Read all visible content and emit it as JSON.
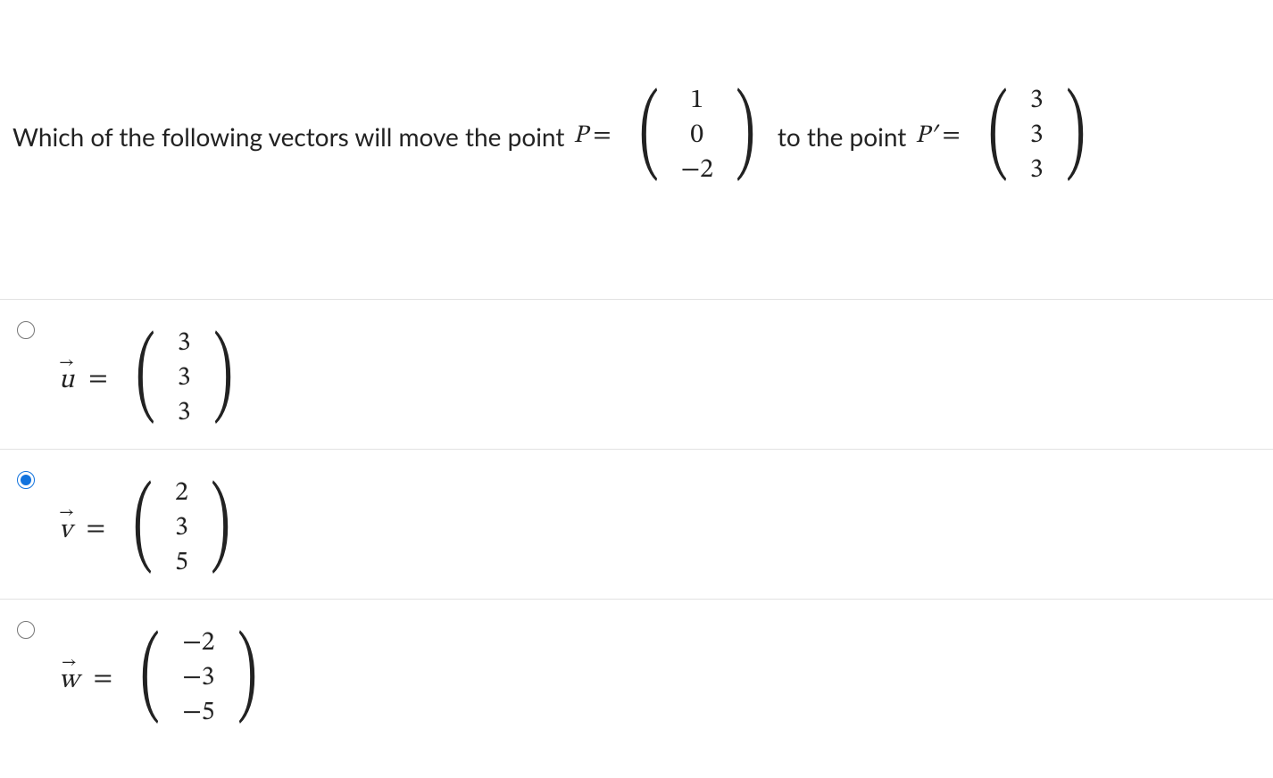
{
  "question": {
    "prefix_text": "Which of the following vectors will move the point ",
    "P_label": "P",
    "P_values": [
      "1",
      "0",
      "−2"
    ],
    "middle_text": " to the point ",
    "Pprime_label": "P′",
    "Pprime_values": [
      "3",
      "3",
      "3"
    ]
  },
  "options": [
    {
      "name": "u",
      "values": [
        "3",
        "3",
        "3"
      ],
      "selected": false
    },
    {
      "name": "v",
      "values": [
        "2",
        "3",
        "5"
      ],
      "selected": true
    },
    {
      "name": "w",
      "values": [
        "−2",
        "−3",
        "−5"
      ],
      "selected": false
    }
  ]
}
